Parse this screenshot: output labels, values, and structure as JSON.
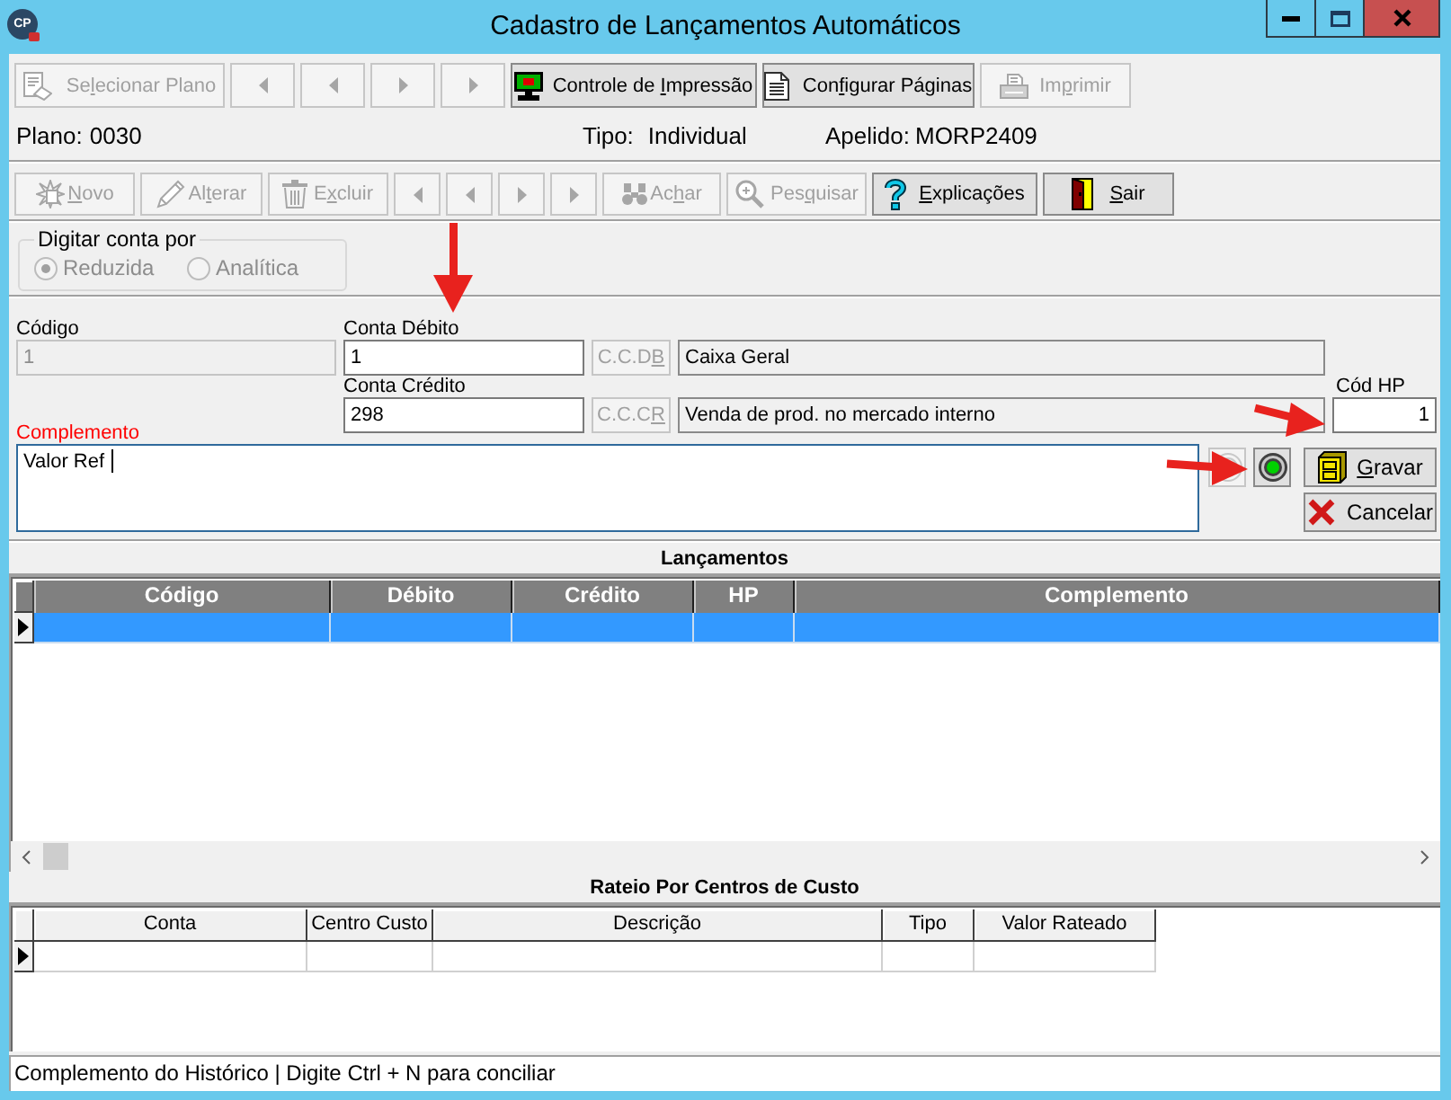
{
  "window": {
    "logo_text": "CP",
    "title": "Cadastro de Lançamentos Automáticos"
  },
  "toolbars": [
    {
      "buttons": [
        {
          "kind": "text",
          "label": "Selecionar Plano",
          "disabled": true
        },
        {
          "kind": "first",
          "disabled": true
        },
        {
          "kind": "previous",
          "disabled": true
        },
        {
          "kind": "next",
          "disabled": true
        },
        {
          "kind": "last",
          "disabled": true
        },
        {
          "kind": "text",
          "label": "Controle de Impressão",
          "disabled": false
        },
        {
          "kind": "text",
          "label": "Configurar Páginas",
          "disabled": false
        },
        {
          "kind": "text",
          "label": "Imprimir",
          "disabled": true
        }
      ]
    },
    {
      "buttons": [
        {
          "kind": "text",
          "label": "Novo",
          "disabled": true
        },
        {
          "kind": "text",
          "label": "Alterar",
          "disabled": true
        },
        {
          "kind": "text",
          "label": "Excluir",
          "disabled": true
        },
        {
          "kind": "first",
          "disabled": true
        },
        {
          "kind": "previous",
          "disabled": true
        },
        {
          "kind": "next",
          "disabled": true
        },
        {
          "kind": "last",
          "disabled": true
        },
        {
          "kind": "text",
          "label": "Achar",
          "disabled": true
        },
        {
          "kind": "text",
          "label": "Pesquisar",
          "disabled": true
        },
        {
          "kind": "text",
          "label": "Explicações",
          "disabled": false
        },
        {
          "kind": "text",
          "label": "Sair",
          "disabled": false
        }
      ]
    }
  ],
  "info": {
    "plan_label": "Plano:",
    "plan": "0030",
    "type_label": "Tipo:",
    "type": "Individual",
    "alias_label": "Apelido:",
    "alias": "MORP2409"
  },
  "account_entry": {
    "legend": "Digitar conta por",
    "options": [
      {
        "label": "Reduzida",
        "selected": true,
        "disabled": true
      },
      {
        "label": "Analítica",
        "selected": false,
        "disabled": true
      }
    ]
  },
  "form": {
    "code": {
      "label": "Código",
      "value": "1",
      "disabled": true
    },
    "debit_account": {
      "label": "Conta Débito",
      "value": "1",
      "cost_center_button": {
        "label": "C.C.DB",
        "disabled": true
      },
      "description": "Caixa Geral"
    },
    "credit_account": {
      "label": "Conta Crédito",
      "value": "298",
      "cost_center_button": {
        "label": "C.C.CR",
        "disabled": true
      },
      "description": "Venda de prod. no mercado interno"
    },
    "hp_code": {
      "label": "Cód HP",
      "value": "1"
    },
    "complement": {
      "label": "Complemento",
      "highlighted": true,
      "value": "Valor Ref",
      "focused": true
    },
    "side_buttons": [
      {
        "disabled": true
      },
      {
        "disabled": false
      }
    ],
    "actions": [
      {
        "label": "Gravar",
        "disabled": false
      },
      {
        "label": "Cancelar",
        "disabled": false
      }
    ]
  },
  "entries": {
    "title": "Lançamentos",
    "columns": [
      "Código",
      "Débito",
      "Crédito",
      "HP",
      "Complemento"
    ],
    "rows": [
      {
        "current": true,
        "selected": true
      }
    ]
  },
  "cost_allocation": {
    "title": "Rateio Por Centros de Custo",
    "columns": [
      "Conta",
      "Centro Custo",
      "Descrição",
      "Tipo",
      "Valor Rateado"
    ],
    "rows": [
      {
        "current": true,
        "selected": false
      }
    ]
  },
  "status_bar": {
    "text": "Complemento do Histórico | Digite Ctrl + N para conciliar"
  }
}
